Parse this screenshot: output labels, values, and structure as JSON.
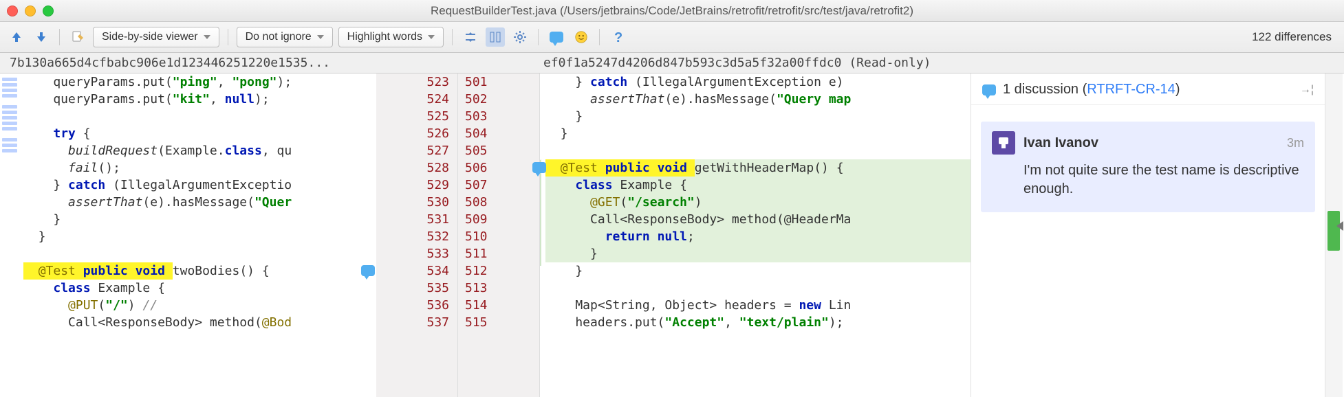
{
  "window": {
    "title": "RequestBuilderTest.java (/Users/jetbrains/Code/JetBrains/retrofit/retrofit/src/test/java/retrofit2)"
  },
  "toolbar": {
    "viewer_mode": "Side-by-side viewer",
    "ignore_mode": "Do not ignore",
    "highlight_mode": "Highlight words",
    "diff_count_label": "122 differences"
  },
  "revisions": {
    "left": "7b130a665d4cfbabc906e1d123446251220e1535...",
    "right": "ef0f1a5247d4206d847b593c3d5a5f32a00ffdc0 (Read-only)"
  },
  "left_lines": [
    {
      "n": 523,
      "html": "    queryParams.put(<span class='str'>\"ping\"</span>, <span class='str'>\"pong\"</span>);"
    },
    {
      "n": 524,
      "html": "    queryParams.put(<span class='str'>\"kit\"</span>, <span class='kw'>null</span>);"
    },
    {
      "n": 525,
      "html": ""
    },
    {
      "n": 526,
      "html": "    <span class='kw'>try</span> {"
    },
    {
      "n": 527,
      "html": "      <span class='it'>buildRequest</span>(Example.<span class='kw'>class</span>, qu"
    },
    {
      "n": 528,
      "html": "      <span class='it'>fail</span>();"
    },
    {
      "n": 529,
      "html": "    } <span class='kw'>catch</span> (IllegalArgumentExceptio"
    },
    {
      "n": 530,
      "html": "      <span class='it'>assertThat</span>(e).hasMessage(<span class='str'>\"Quer</span>"
    },
    {
      "n": 531,
      "html": "    }"
    },
    {
      "n": 532,
      "html": "  }"
    },
    {
      "n": 533,
      "html": ""
    },
    {
      "n": 534,
      "html": "<span class='codeline hl-yellow'>  <span class='ann'>@Test</span> <span class='kw'>public</span> <span class='kw'>void</span> </span>twoBodies() {",
      "marker": true
    },
    {
      "n": 535,
      "html": "    <span class='kw'>class</span> Example {"
    },
    {
      "n": 536,
      "html": "      <span class='ann'>@PUT</span>(<span class='str'>\"/\"</span>) <span class='cmt'>//</span>"
    },
    {
      "n": 537,
      "html": "      Call&lt;ResponseBody&gt; method(<span class='ann'>@Bod</span>"
    }
  ],
  "right_lines": [
    {
      "n": 501,
      "html": "    } <span class='kw'>catch</span> (IllegalArgumentException e)"
    },
    {
      "n": 502,
      "html": "      <span class='it'>assertThat</span>(e).hasMessage(<span class='str'>\"Query map</span>"
    },
    {
      "n": 503,
      "html": "    }"
    },
    {
      "n": 504,
      "html": "  }"
    },
    {
      "n": 505,
      "html": ""
    },
    {
      "n": 506,
      "html": "<span class='codeline hl-yellow'>  <span class='ann'>@Test</span> <span class='kw'>public</span> <span class='kw'>void</span> </span>getWithHeaderMap() {",
      "green": true,
      "marker": true
    },
    {
      "n": 507,
      "html": "    <span class='kw'>class</span> Example {",
      "green": true
    },
    {
      "n": 508,
      "html": "      <span class='ann'>@GET</span>(<span class='str'>\"/search\"</span>)",
      "green": true
    },
    {
      "n": 509,
      "html": "      Call&lt;ResponseBody&gt; method(@HeaderMa",
      "green": true
    },
    {
      "n": 510,
      "html": "        <span class='kw'>return</span> <span class='kw'>null</span>;",
      "green": true
    },
    {
      "n": 511,
      "html": "      }",
      "green": true
    },
    {
      "n": 512,
      "html": "    }"
    },
    {
      "n": 513,
      "html": ""
    },
    {
      "n": 514,
      "html": "    Map&lt;String, Object&gt; headers = <span class='kw'>new</span> Lin"
    },
    {
      "n": 515,
      "html": "    headers.put(<span class='str'>\"Accept\"</span>, <span class='str'>\"text/plain\"</span>);"
    }
  ],
  "discussion": {
    "header_prefix": "1 discussion (",
    "ticket": "RTRFT-CR-14",
    "header_suffix": ")",
    "goto": "→¦",
    "comment": {
      "author": "Ivan Ivanov",
      "time": "3m",
      "body": "I'm not quite sure the test name is descriptive enough."
    }
  }
}
